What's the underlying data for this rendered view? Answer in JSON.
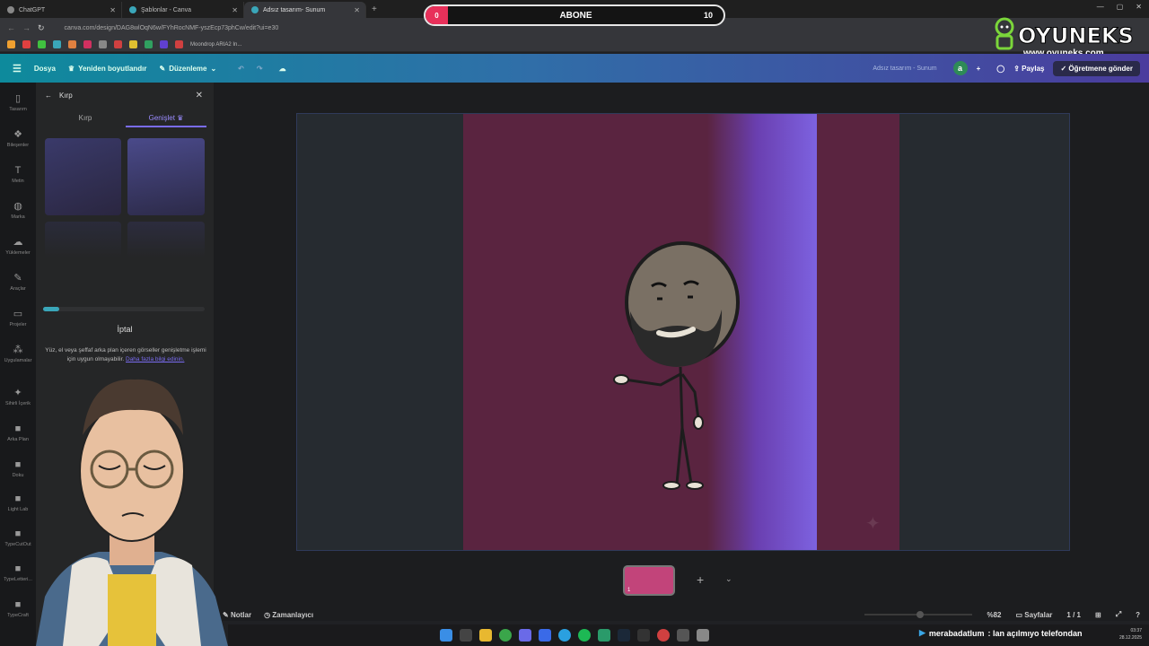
{
  "browser": {
    "tabs": [
      {
        "label": "ChatGPT",
        "active": false
      },
      {
        "label": "Şablonlar - Canva",
        "active": false
      },
      {
        "label": "Adsız tasarım- Sunum",
        "active": true
      }
    ],
    "url": "canva.com/design/DAG8wlOqN6w/FYhRocNMF-yszEcp73phCw/edit?ui=e30",
    "bookmark": "Moondrop ARIA2 In..."
  },
  "overlay": {
    "subscribe_label": "ABONE",
    "start_value": "0",
    "end_value": "10",
    "accent": "#e8305a"
  },
  "logo": {
    "name": "OYUNEKS",
    "url": "www.oyuneks.com"
  },
  "toolbar": {
    "file": "Dosya",
    "resize": "Yeniden boyutlandır",
    "edit": "Düzenleme",
    "doc_title": "Adsız tasarım - Sunum",
    "avatar_letter": "a",
    "share": "Paylaş",
    "send_teacher": "Öğretmene gönder"
  },
  "rail": [
    {
      "label": "Tasarım",
      "icon": "layout-icon"
    },
    {
      "label": "Bileşenler",
      "icon": "elements-icon"
    },
    {
      "label": "Metin",
      "icon": "text-icon"
    },
    {
      "label": "Marka",
      "icon": "brand-icon"
    },
    {
      "label": "Yüklemeler",
      "icon": "upload-icon"
    },
    {
      "label": "Araçlar",
      "icon": "draw-icon"
    },
    {
      "label": "Projeler",
      "icon": "folder-icon"
    },
    {
      "label": "Uygulamalar",
      "icon": "apps-icon"
    },
    {
      "label": "Sihirli İçerik",
      "icon": "magic-icon"
    },
    {
      "label": "Arka Plan",
      "icon": "background-icon"
    },
    {
      "label": "Doku",
      "icon": "texture-icon"
    },
    {
      "label": "Light Lab",
      "icon": "light-icon"
    },
    {
      "label": "TypeCutOut",
      "icon": "cutout-icon"
    },
    {
      "label": "TypeLetteri...",
      "icon": "letter-icon"
    },
    {
      "label": "TypeCraft",
      "icon": "craft-icon"
    }
  ],
  "panel": {
    "title": "Kırp",
    "tabs": [
      "Kırp",
      "Genişlet"
    ],
    "active_tab": 1,
    "progress": 0.1,
    "cancel": "İptal",
    "note": "Yüz, el veya şeffaf arka plan içeren görseller genişletme işlemi için uygun olmayabilir.",
    "note_link": "Daha fazla bilgi edinin."
  },
  "bottom": {
    "notes": "Notlar",
    "timer": "Zamanlayıcı",
    "zoom": "%82",
    "pages": "Sayfalar",
    "page_count": "1 / 1",
    "page_thumb_number": "1"
  },
  "taskbar": {
    "chat_user": "merabadatlum",
    "chat_text": ": lan açılmıyo telefondan",
    "time": "03:37",
    "date": "28.12.2025"
  }
}
